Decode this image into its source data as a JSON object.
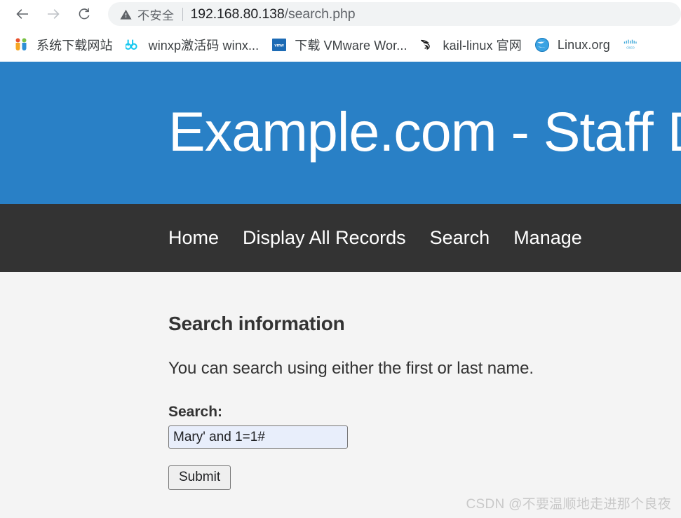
{
  "browser": {
    "back_icon": "arrow-left-icon",
    "forward_icon": "arrow-right-icon",
    "reload_icon": "reload-icon",
    "omnibox": {
      "security_icon": "warning-triangle-icon",
      "security_label": "不安全",
      "url_host": "192.168.80.138",
      "url_path": "/search.php",
      "full_url": "192.168.80.138/search.php"
    },
    "bookmarks": [
      {
        "icon": "xitongxiazai-site-icon",
        "label": "系统下载网站"
      },
      {
        "icon": "dd-glasses-icon",
        "label": "winxp激活码 winx..."
      },
      {
        "icon": "vmware-icon",
        "label": "下载 VMware Wor..."
      },
      {
        "icon": "kali-dragon-icon",
        "label": "kail-linux 官网"
      },
      {
        "icon": "globe-icon",
        "label": "Linux.org"
      },
      {
        "icon": "cisco-icon",
        "label": ""
      }
    ]
  },
  "site": {
    "banner_title": "Example.com - Staff De",
    "banner_color": "#2980c6",
    "nav_color": "#333333",
    "nav_items": [
      {
        "label": "Home"
      },
      {
        "label": "Display All Records"
      },
      {
        "label": "Search"
      },
      {
        "label": "Manage"
      }
    ]
  },
  "main": {
    "heading": "Search information",
    "description": "You can search using either the first or last name.",
    "search_label": "Search:",
    "search_value": "Mary' and 1=1#",
    "search_placeholder": "",
    "submit_label": "Submit"
  },
  "watermark": {
    "text": "CSDN @不要温顺地走进那个良夜"
  }
}
